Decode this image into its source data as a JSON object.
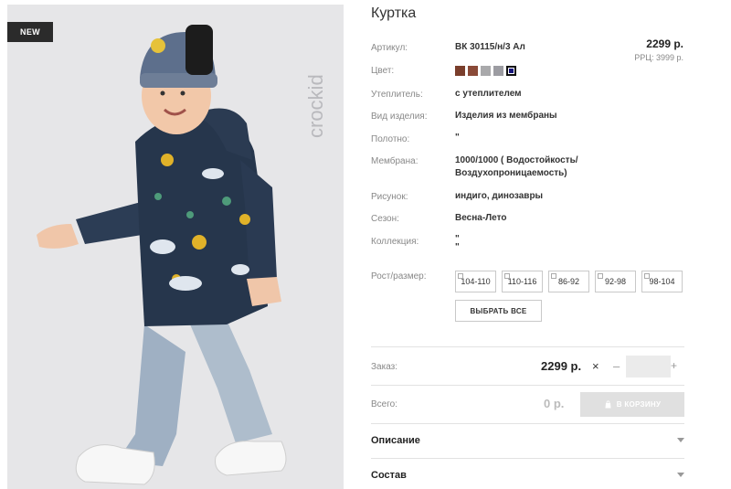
{
  "image": {
    "badge": "NEW",
    "brand_logo": "crockid"
  },
  "product": {
    "title": "Куртка",
    "price": "2299 р.",
    "rrp": "РРЦ: 3999 р."
  },
  "attributes": {
    "article_label": "Артикул:",
    "article_value": "ВК 30115/н/3 Ал",
    "color_label": "Цвет:",
    "colors": [
      "#7a3e2c",
      "#8a4a38",
      "#a9a9ab",
      "#9c9ca2",
      "#15147a"
    ],
    "insulation_label": "Утеплитель:",
    "insulation_value": "с утеплителем",
    "type_label": "Вид изделия:",
    "type_value": "Изделия из мембраны",
    "fabric_label": "Полотно:",
    "fabric_value": "\"",
    "membrane_label": "Мембрана:",
    "membrane_value_1": "1000/1000 ( Водостойкость/",
    "membrane_value_2": "Воздухопроницаемость)",
    "pattern_label": "Рисунок:",
    "pattern_value": "индиго, динозавры",
    "season_label": "Сезон:",
    "season_value": "Весна-Лето",
    "collection_label": "Коллекция:",
    "collection_value_1": "\"",
    "collection_value_2": "\""
  },
  "sizes": {
    "label": "Рост/размер:",
    "options": [
      "104-110",
      "110-116",
      "86-92",
      "92-98",
      "98-104"
    ],
    "select_all": "ВЫБРАТЬ ВСЕ"
  },
  "order": {
    "label": "Заказ:",
    "price": "2299 р.",
    "times": "×",
    "minus": "–",
    "plus": "+",
    "quantity": ""
  },
  "total": {
    "label": "Всего:",
    "value": "0 р.",
    "cart_button": "В КОРЗИНУ"
  },
  "accordion": {
    "description": "Описание",
    "composition": "Состав"
  }
}
